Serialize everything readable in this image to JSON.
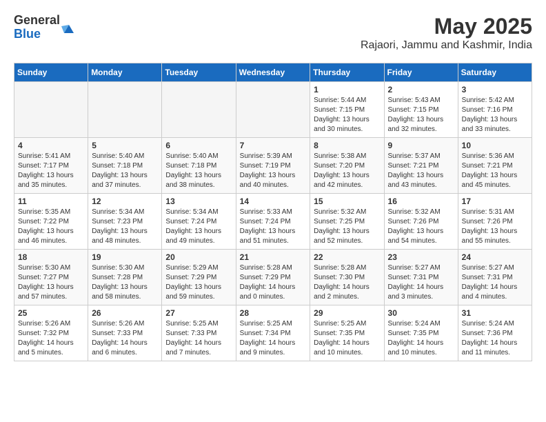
{
  "logo": {
    "general": "General",
    "blue": "Blue"
  },
  "title": {
    "month_year": "May 2025",
    "location": "Rajaori, Jammu and Kashmir, India"
  },
  "days_of_week": [
    "Sunday",
    "Monday",
    "Tuesday",
    "Wednesday",
    "Thursday",
    "Friday",
    "Saturday"
  ],
  "weeks": [
    [
      {
        "day": "",
        "info": ""
      },
      {
        "day": "",
        "info": ""
      },
      {
        "day": "",
        "info": ""
      },
      {
        "day": "",
        "info": ""
      },
      {
        "day": "1",
        "info": "Sunrise: 5:44 AM\nSunset: 7:15 PM\nDaylight: 13 hours\nand 30 minutes."
      },
      {
        "day": "2",
        "info": "Sunrise: 5:43 AM\nSunset: 7:15 PM\nDaylight: 13 hours\nand 32 minutes."
      },
      {
        "day": "3",
        "info": "Sunrise: 5:42 AM\nSunset: 7:16 PM\nDaylight: 13 hours\nand 33 minutes."
      }
    ],
    [
      {
        "day": "4",
        "info": "Sunrise: 5:41 AM\nSunset: 7:17 PM\nDaylight: 13 hours\nand 35 minutes."
      },
      {
        "day": "5",
        "info": "Sunrise: 5:40 AM\nSunset: 7:18 PM\nDaylight: 13 hours\nand 37 minutes."
      },
      {
        "day": "6",
        "info": "Sunrise: 5:40 AM\nSunset: 7:18 PM\nDaylight: 13 hours\nand 38 minutes."
      },
      {
        "day": "7",
        "info": "Sunrise: 5:39 AM\nSunset: 7:19 PM\nDaylight: 13 hours\nand 40 minutes."
      },
      {
        "day": "8",
        "info": "Sunrise: 5:38 AM\nSunset: 7:20 PM\nDaylight: 13 hours\nand 42 minutes."
      },
      {
        "day": "9",
        "info": "Sunrise: 5:37 AM\nSunset: 7:21 PM\nDaylight: 13 hours\nand 43 minutes."
      },
      {
        "day": "10",
        "info": "Sunrise: 5:36 AM\nSunset: 7:21 PM\nDaylight: 13 hours\nand 45 minutes."
      }
    ],
    [
      {
        "day": "11",
        "info": "Sunrise: 5:35 AM\nSunset: 7:22 PM\nDaylight: 13 hours\nand 46 minutes."
      },
      {
        "day": "12",
        "info": "Sunrise: 5:34 AM\nSunset: 7:23 PM\nDaylight: 13 hours\nand 48 minutes."
      },
      {
        "day": "13",
        "info": "Sunrise: 5:34 AM\nSunset: 7:24 PM\nDaylight: 13 hours\nand 49 minutes."
      },
      {
        "day": "14",
        "info": "Sunrise: 5:33 AM\nSunset: 7:24 PM\nDaylight: 13 hours\nand 51 minutes."
      },
      {
        "day": "15",
        "info": "Sunrise: 5:32 AM\nSunset: 7:25 PM\nDaylight: 13 hours\nand 52 minutes."
      },
      {
        "day": "16",
        "info": "Sunrise: 5:32 AM\nSunset: 7:26 PM\nDaylight: 13 hours\nand 54 minutes."
      },
      {
        "day": "17",
        "info": "Sunrise: 5:31 AM\nSunset: 7:26 PM\nDaylight: 13 hours\nand 55 minutes."
      }
    ],
    [
      {
        "day": "18",
        "info": "Sunrise: 5:30 AM\nSunset: 7:27 PM\nDaylight: 13 hours\nand 57 minutes."
      },
      {
        "day": "19",
        "info": "Sunrise: 5:30 AM\nSunset: 7:28 PM\nDaylight: 13 hours\nand 58 minutes."
      },
      {
        "day": "20",
        "info": "Sunrise: 5:29 AM\nSunset: 7:29 PM\nDaylight: 13 hours\nand 59 minutes."
      },
      {
        "day": "21",
        "info": "Sunrise: 5:28 AM\nSunset: 7:29 PM\nDaylight: 14 hours\nand 0 minutes."
      },
      {
        "day": "22",
        "info": "Sunrise: 5:28 AM\nSunset: 7:30 PM\nDaylight: 14 hours\nand 2 minutes."
      },
      {
        "day": "23",
        "info": "Sunrise: 5:27 AM\nSunset: 7:31 PM\nDaylight: 14 hours\nand 3 minutes."
      },
      {
        "day": "24",
        "info": "Sunrise: 5:27 AM\nSunset: 7:31 PM\nDaylight: 14 hours\nand 4 minutes."
      }
    ],
    [
      {
        "day": "25",
        "info": "Sunrise: 5:26 AM\nSunset: 7:32 PM\nDaylight: 14 hours\nand 5 minutes."
      },
      {
        "day": "26",
        "info": "Sunrise: 5:26 AM\nSunset: 7:33 PM\nDaylight: 14 hours\nand 6 minutes."
      },
      {
        "day": "27",
        "info": "Sunrise: 5:25 AM\nSunset: 7:33 PM\nDaylight: 14 hours\nand 7 minutes."
      },
      {
        "day": "28",
        "info": "Sunrise: 5:25 AM\nSunset: 7:34 PM\nDaylight: 14 hours\nand 9 minutes."
      },
      {
        "day": "29",
        "info": "Sunrise: 5:25 AM\nSunset: 7:35 PM\nDaylight: 14 hours\nand 10 minutes."
      },
      {
        "day": "30",
        "info": "Sunrise: 5:24 AM\nSunset: 7:35 PM\nDaylight: 14 hours\nand 10 minutes."
      },
      {
        "day": "31",
        "info": "Sunrise: 5:24 AM\nSunset: 7:36 PM\nDaylight: 14 hours\nand 11 minutes."
      }
    ]
  ]
}
